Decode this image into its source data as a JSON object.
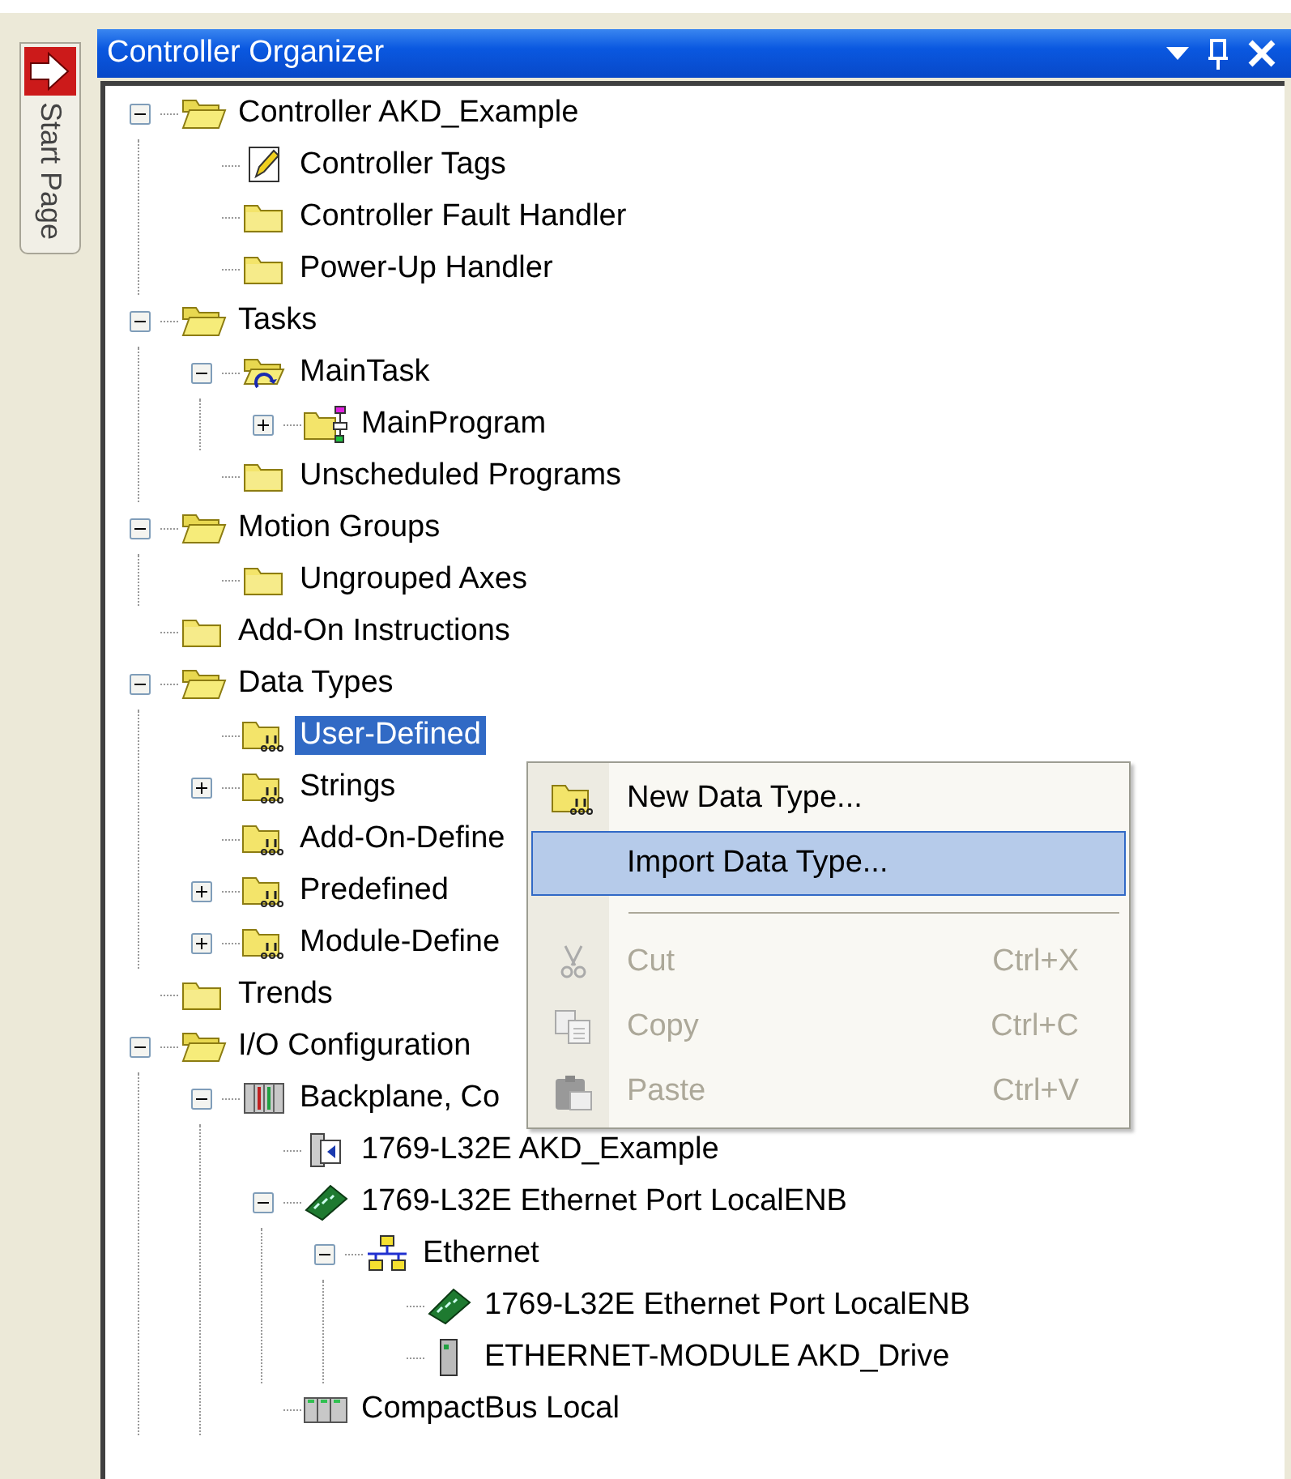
{
  "side_tab": {
    "label": "Start Page"
  },
  "panel": {
    "title": "Controller Organizer"
  },
  "tree": {
    "items": [
      {
        "label": "Controller AKD_Example",
        "kind": "folder-open",
        "expanded": true,
        "selected": false,
        "children": [
          {
            "label": "Controller Tags",
            "kind": "tags",
            "selected": false
          },
          {
            "label": "Controller Fault Handler",
            "kind": "folder",
            "selected": false
          },
          {
            "label": "Power-Up Handler",
            "kind": "folder",
            "selected": false
          }
        ]
      },
      {
        "label": "Tasks",
        "kind": "folder-open",
        "expanded": true,
        "selected": false,
        "children": [
          {
            "label": "MainTask",
            "kind": "task",
            "expanded": true,
            "selected": false,
            "children": [
              {
                "label": "MainProgram",
                "kind": "program",
                "expanded": false,
                "selected": false
              }
            ]
          },
          {
            "label": "Unscheduled Programs",
            "kind": "folder",
            "selected": false
          }
        ]
      },
      {
        "label": "Motion Groups",
        "kind": "folder-open",
        "expanded": true,
        "selected": false,
        "children": [
          {
            "label": "Ungrouped Axes",
            "kind": "folder",
            "selected": false
          }
        ]
      },
      {
        "label": "Add-On Instructions",
        "kind": "folder",
        "selected": false
      },
      {
        "label": "Data Types",
        "kind": "folder-open",
        "expanded": true,
        "selected": false,
        "children": [
          {
            "label": "User-Defined",
            "kind": "datatype",
            "selected": true
          },
          {
            "label": "Strings",
            "kind": "datatype",
            "expanded": false,
            "selected": false
          },
          {
            "label": "Add-On-Define",
            "kind": "datatype",
            "selected": false
          },
          {
            "label": "Predefined",
            "kind": "datatype",
            "expanded": false,
            "selected": false
          },
          {
            "label": "Module-Define",
            "kind": "datatype",
            "expanded": false,
            "selected": false
          }
        ]
      },
      {
        "label": "Trends",
        "kind": "folder",
        "selected": false
      },
      {
        "label": "I/O Configuration",
        "kind": "folder-open",
        "expanded": true,
        "selected": false,
        "children": [
          {
            "label": "Backplane, Co",
            "kind": "backplane",
            "expanded": true,
            "selected": false,
            "children": [
              {
                "label": "1769-L32E AKD_Example",
                "kind": "controller",
                "selected": false
              },
              {
                "label": "1769-L32E Ethernet Port LocalENB",
                "kind": "ethernet-card",
                "expanded": true,
                "selected": false,
                "children": [
                  {
                    "label": "Ethernet",
                    "kind": "network",
                    "expanded": true,
                    "selected": false,
                    "children": [
                      {
                        "label": "1769-L32E Ethernet Port LocalENB",
                        "kind": "ethernet-card",
                        "selected": false
                      },
                      {
                        "label": "ETHERNET-MODULE AKD_Drive",
                        "kind": "drive",
                        "selected": false
                      }
                    ]
                  }
                ]
              },
              {
                "label": "CompactBus Local",
                "kind": "bus",
                "selected": false
              }
            ]
          }
        ]
      }
    ]
  },
  "context_menu": {
    "items": [
      {
        "kind": "datatype",
        "label": "New Data Type...",
        "selected": false,
        "disabled": false
      },
      {
        "kind": "plain",
        "label": "Import Data Type...",
        "selected": true,
        "disabled": false
      },
      {
        "kind": "separator"
      },
      {
        "kind": "scissors",
        "label": "Cut",
        "shortcut": "Ctrl+X",
        "selected": false,
        "disabled": true
      },
      {
        "kind": "copy",
        "label": "Copy",
        "shortcut": "Ctrl+C",
        "selected": false,
        "disabled": true
      },
      {
        "kind": "paste",
        "label": "Paste",
        "shortcut": "Ctrl+V",
        "selected": false,
        "disabled": true
      }
    ]
  }
}
